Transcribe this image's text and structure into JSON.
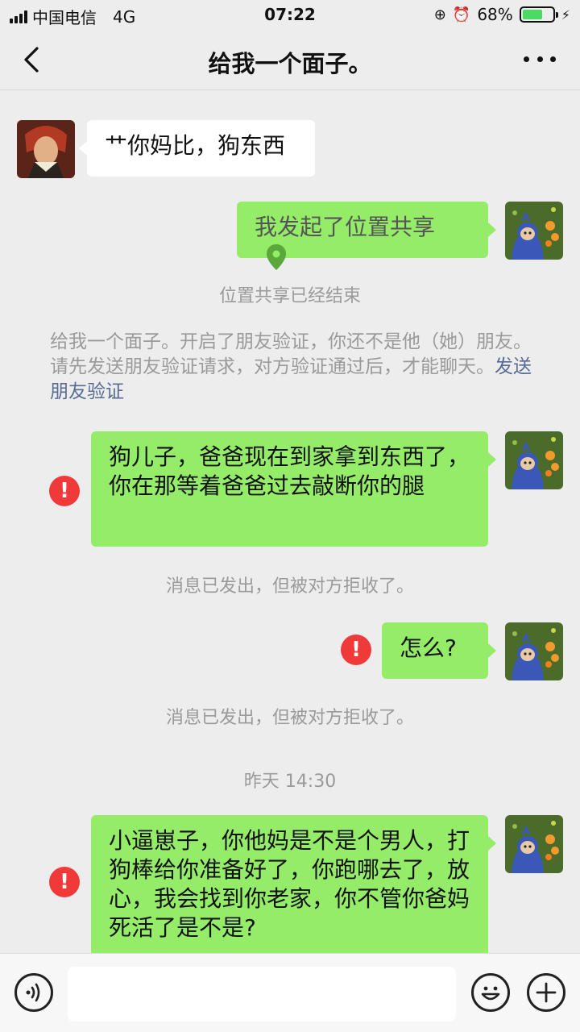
{
  "status": {
    "carrier": "中国电信",
    "network": "4G",
    "time": "07:22",
    "battery": "68%",
    "battery_level": 0.68
  },
  "nav": {
    "title": "给我一个面子。"
  },
  "messages": {
    "m1": "艹你妈比，狗东西",
    "m2": "我发起了位置共享",
    "sys1": "位置共享已经结束",
    "notice_text": "给我一个面子。开启了朋友验证，你还不是他（她）朋友。请先发送朋友验证请求，对方验证通过后，才能聊天。",
    "notice_link": "发送朋友验证",
    "m3": "狗儿子，爸爸现在到家拿到东西了，你在那等着爸爸过去敲断你的腿",
    "rejected": "消息已发出，但被对方拒收了。",
    "m4": "怎么?",
    "timestamp": "昨天 14:30",
    "m5": "小逼崽子，你他妈是不是个男人，打狗棒给你准备好了，你跑哪去了，放心，我会找到你老家，你不管你爸妈死活了是不是?"
  },
  "colors": {
    "bubble_green": "#95ec69",
    "bubble_white": "#ffffff",
    "error_red": "#f03a3a",
    "link": "#576b95"
  },
  "icons": [
    "back-arrow-icon",
    "more-dots-icon",
    "location-pin-icon",
    "error-icon",
    "voice-icon",
    "emoji-icon",
    "plus-icon"
  ]
}
